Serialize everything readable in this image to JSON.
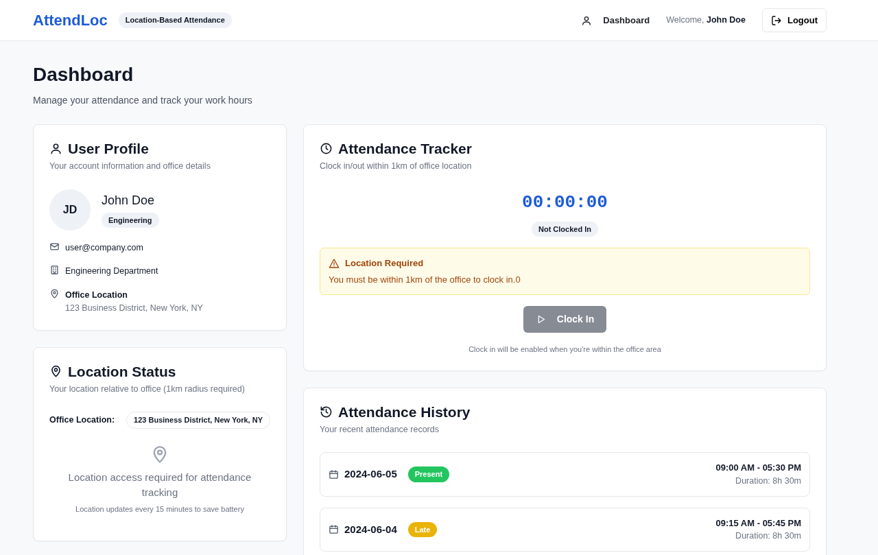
{
  "navbar": {
    "brand": "AttendLoc",
    "tagline": "Location-Based Attendance",
    "nav_link": "Dashboard",
    "welcome_label": "Welcome,",
    "welcome_name": "John Doe",
    "logout": "Logout"
  },
  "page": {
    "title": "Dashboard",
    "subtitle": "Manage your attendance and track your work hours"
  },
  "user_profile": {
    "title": "User Profile",
    "subtitle": "Your account information and office details",
    "initials": "JD",
    "name": "John Doe",
    "department_badge": "Engineering",
    "email": "user@company.com",
    "department": "Engineering Department",
    "office_label": "Office Location",
    "office_address": "123 Business District, New York, NY"
  },
  "location_status": {
    "title": "Location Status",
    "subtitle": "Your location relative to office (1km radius required)",
    "office_label": "Office Location:",
    "office_address": "123 Business District, New York, NY",
    "message": "Location access required for attendance tracking",
    "note": "Location updates every 15 minutes to save battery"
  },
  "attendance_tracker": {
    "title": "Attendance Tracker",
    "subtitle": "Clock in/out within 1km of office location",
    "timer": "00:00:00",
    "status": "Not Clocked In",
    "alert": {
      "title": "Location Required",
      "message": "You must be within 1km of the office to clock in.0"
    },
    "clock_button": {
      "label": "Clock In",
      "disabled": true
    },
    "hint": "Clock in will be enabled when you're within the office area"
  },
  "attendance_history": {
    "title": "Attendance History",
    "subtitle": "Your recent attendance records",
    "records": [
      {
        "date": "2024-06-05",
        "status": "Present",
        "color": "#22c55e",
        "time": "09:00 AM - 05:30 PM",
        "duration": "Duration: 8h 30m"
      },
      {
        "date": "2024-06-04",
        "status": "Late",
        "color": "#eab308",
        "time": "09:15 AM - 05:45 PM",
        "duration": "Duration: 8h 30m"
      }
    ]
  }
}
